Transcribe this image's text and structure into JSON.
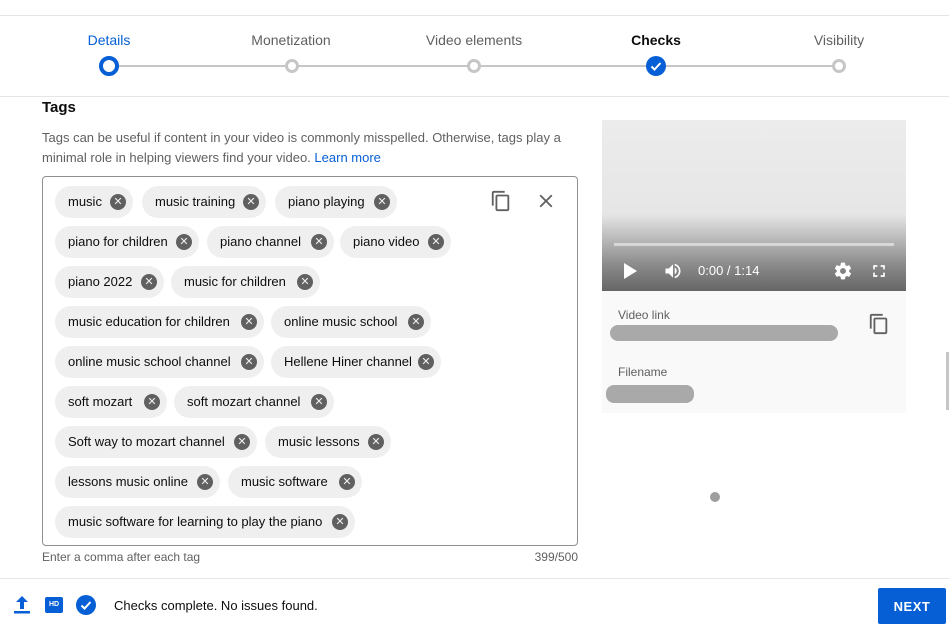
{
  "stepper": {
    "steps": [
      {
        "label": "Details",
        "state": "current"
      },
      {
        "label": "Monetization",
        "state": "pending"
      },
      {
        "label": "Video elements",
        "state": "pending"
      },
      {
        "label": "Checks",
        "state": "done"
      },
      {
        "label": "Visibility",
        "state": "pending"
      }
    ]
  },
  "tags": {
    "title": "Tags",
    "description": "Tags can be useful if content in your video is commonly misspelled. Otherwise, tags play a minimal role in helping viewers find your video.",
    "learn_more": "Learn more",
    "items": [
      "music",
      "music training",
      "piano playing",
      "piano for children",
      "piano channel",
      "piano video",
      "piano 2022",
      "music for children",
      "music education for children",
      "online music school",
      "online music school channel",
      "Hellene Hiner channel",
      "soft mozart",
      "soft mozart channel",
      "Soft way to mozart channel",
      "music lessons",
      "lessons music online",
      "music software",
      "music software for learning to play the piano"
    ],
    "helper": "Enter a comma after each tag",
    "count": "399/500"
  },
  "preview": {
    "time": "0:00 / 1:14",
    "video_link_label": "Video link",
    "filename_label": "Filename"
  },
  "footer": {
    "status": "Checks complete. No issues found.",
    "next_label": "NEXT",
    "hd_label": "HD"
  },
  "colors": {
    "accent": "#065fd4",
    "chip": "#efefef"
  }
}
